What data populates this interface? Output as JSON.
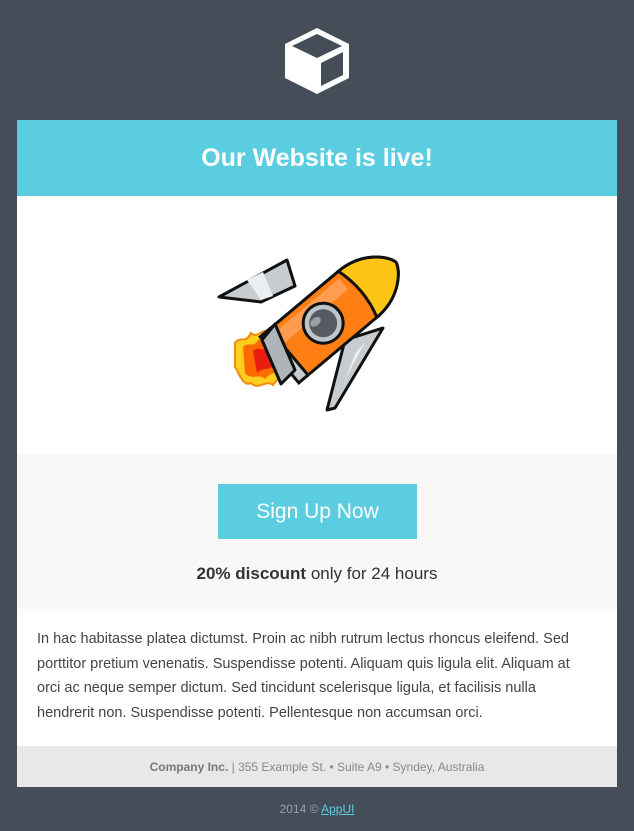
{
  "logo": {
    "icon": "cube-icon"
  },
  "hero": {
    "title": "Our Website is live!",
    "image": "rocket-illustration"
  },
  "cta": {
    "button_label": "Sign Up Now",
    "discount_bold": "20% discount",
    "discount_rest": " only for 24 hours"
  },
  "body": {
    "paragraph": "In hac habitasse platea dictumst. Proin ac nibh rutrum lectus rhoncus eleifend. Sed porttitor pretium venenatis. Suspendisse potenti. Aliquam quis ligula elit. Aliquam at orci ac neque semper dictum. Sed tincidunt scelerisque ligula, et facilisis nulla hendrerit non. Suspendisse potenti. Pellentesque non accumsan orci."
  },
  "footer": {
    "company": "Company Inc.",
    "address": " | 355 Example St. • Suite A9 • Syndey, Australia"
  },
  "bottom": {
    "copyright": "2014 © ",
    "link": "AppUI"
  },
  "colors": {
    "background": "#454d59",
    "accent": "#5bcde0"
  }
}
